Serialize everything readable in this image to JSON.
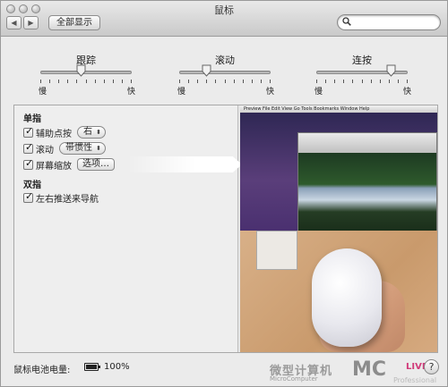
{
  "window": {
    "title": "鼠标"
  },
  "toolbar": {
    "back_icon": "◀",
    "forward_icon": "▶",
    "show_all": "全部显示",
    "search_placeholder": ""
  },
  "sliders": [
    {
      "label": "跟踪",
      "min": "慢",
      "max": "快",
      "value": 0.45
    },
    {
      "label": "滚动",
      "min": "慢",
      "max": "快",
      "value": 0.3
    },
    {
      "label": "连按",
      "min": "慢",
      "max": "快",
      "value": 0.82
    }
  ],
  "sections": {
    "single": "单指",
    "double": "双指"
  },
  "options": {
    "secondary_click": {
      "label": "辅助点按",
      "checked": true,
      "value": "右"
    },
    "scrolling": {
      "label": "滚动",
      "checked": true,
      "value": "带惯性"
    },
    "screen_zoom": {
      "label": "屏幕缩放",
      "checked": true,
      "button": "选项…"
    },
    "swipe_nav": {
      "label": "左右推送来导航",
      "checked": true
    }
  },
  "preview": {
    "menubar": "  Preview  File  Edit  View  Go  Tools  Bookmarks  Window  Help"
  },
  "battery": {
    "label": "鼠标电池电量:",
    "value": "100%",
    "level": 1.0
  },
  "help_icon": "?",
  "watermark": {
    "cn": "微型计算机",
    "en": "MicroComputer",
    "mc": "MC",
    "live": "LIVE",
    "pro": "Professional"
  },
  "colors": {
    "accent_watermark": "#d13b7a",
    "panel_bg": "#eeeeee"
  }
}
